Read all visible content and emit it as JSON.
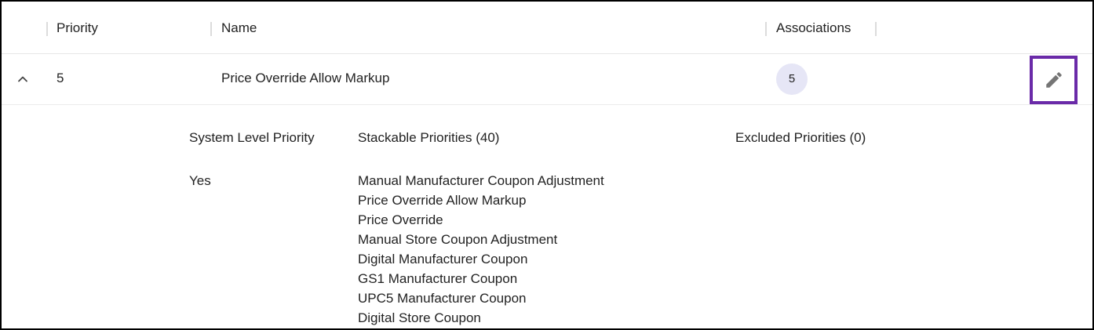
{
  "table": {
    "columns": {
      "priority": "Priority",
      "name": "Name",
      "associations": "Associations"
    },
    "row": {
      "priority": "5",
      "name": "Price Override Allow Markup",
      "associations": "5",
      "expanded": true
    }
  },
  "detail": {
    "system_level_label": "System Level Priority",
    "system_level_value": "Yes",
    "stackable_label": "Stackable Priorities (40)",
    "excluded_label": "Excluded Priorities (0)",
    "stackable_items": [
      "Manual Manufacturer Coupon Adjustment",
      "Price Override Allow Markup",
      "Price Override",
      "Manual Store Coupon Adjustment",
      "Digital Manufacturer Coupon",
      "GS1 Manufacturer Coupon",
      "UPC5 Manufacturer Coupon",
      "Digital Store Coupon"
    ]
  },
  "icons": {
    "expand": "chevron-up-icon",
    "edit": "pencil-icon"
  },
  "colors": {
    "highlight_border": "#6a2aa8",
    "badge_bg": "#e6e6f6",
    "icon_gray": "#757575"
  }
}
